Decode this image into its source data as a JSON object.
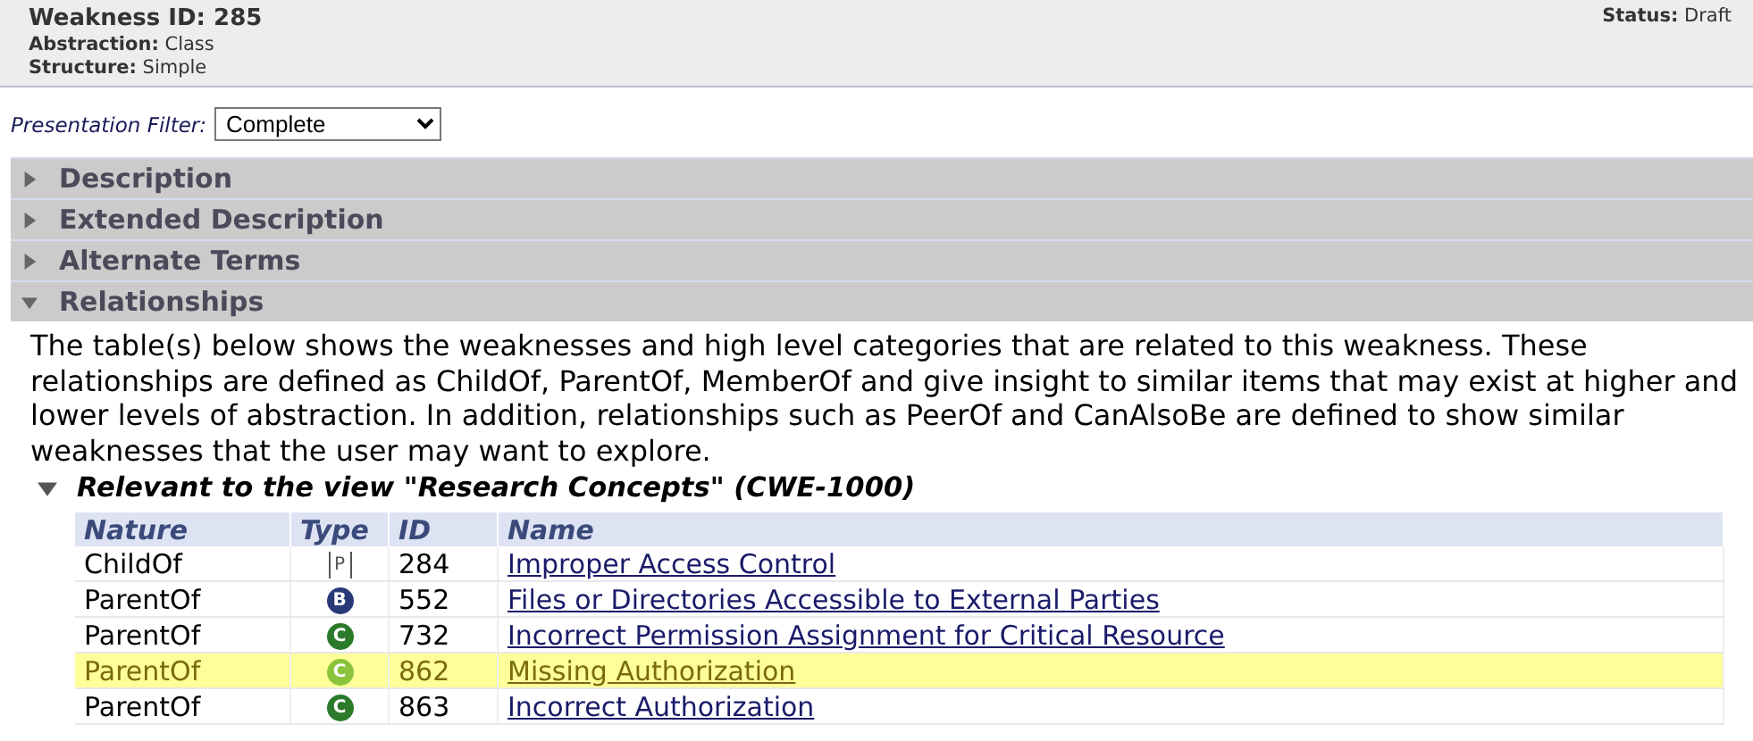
{
  "header": {
    "title": "Weakness ID: 285",
    "fields": [
      {
        "label": "Abstraction:",
        "value": "Class"
      },
      {
        "label": "Structure:",
        "value": "Simple"
      }
    ],
    "status": {
      "label": "Status:",
      "value": "Draft"
    }
  },
  "filter": {
    "label": "Presentation Filter:",
    "value": "Complete"
  },
  "sections": [
    {
      "title": "Description",
      "expanded": false
    },
    {
      "title": "Extended Description",
      "expanded": false
    },
    {
      "title": "Alternate Terms",
      "expanded": false
    },
    {
      "title": "Relationships",
      "expanded": true
    }
  ],
  "relationships": {
    "intro": "The table(s) below shows the weaknesses and high level categories that are related to this weakness. These relationships are defined as ChildOf, ParentOf, MemberOf and give insight to similar items that may exist at higher and lower levels of abstraction. In addition, relationships such as PeerOf and CanAlsoBe are defined to show similar weaknesses that the user may want to explore.",
    "view": {
      "title": "Relevant to the view \"Research Concepts\" (CWE-1000)",
      "expanded": true,
      "columns": [
        "Nature",
        "Type",
        "ID",
        "Name"
      ],
      "rows": [
        {
          "nature": "ChildOf",
          "kind": "pillar",
          "type_letter": "P",
          "id": "284",
          "name": "Improper Access Control",
          "highlighted": false
        },
        {
          "nature": "ParentOf",
          "kind": "base",
          "type_letter": "B",
          "id": "552",
          "name": "Files or Directories Accessible to External Parties",
          "highlighted": false
        },
        {
          "nature": "ParentOf",
          "kind": "class",
          "type_letter": "C",
          "id": "732",
          "name": "Incorrect Permission Assignment for Critical Resource",
          "highlighted": false
        },
        {
          "nature": "ParentOf",
          "kind": "class",
          "type_letter": "C",
          "id": "862",
          "name": "Missing Authorization",
          "highlighted": true
        },
        {
          "nature": "ParentOf",
          "kind": "class",
          "type_letter": "C",
          "id": "863",
          "name": "Incorrect Authorization",
          "highlighted": false
        }
      ]
    }
  }
}
